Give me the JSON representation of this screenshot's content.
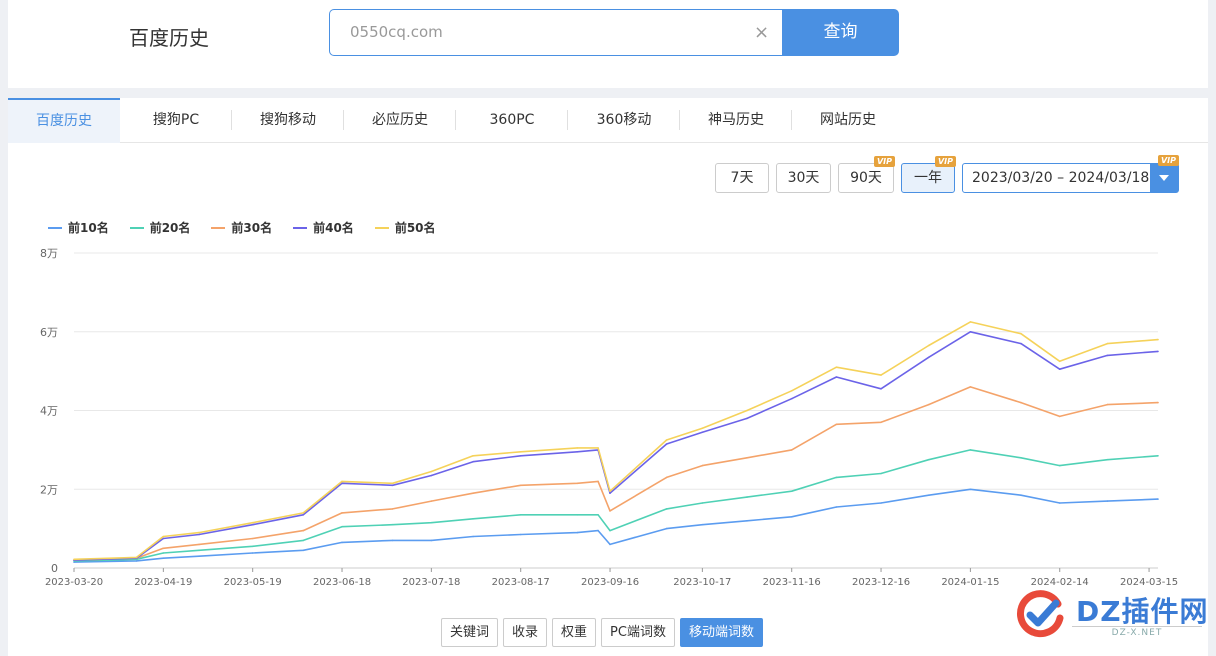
{
  "header": {
    "title": "百度历史",
    "search_value": "0550cq.com",
    "clear_symbol": "×",
    "search_button": "查询"
  },
  "tabs": [
    {
      "label": "百度历史",
      "active": true
    },
    {
      "label": "搜狗PC",
      "active": false
    },
    {
      "label": "搜狗移动",
      "active": false
    },
    {
      "label": "必应历史",
      "active": false
    },
    {
      "label": "360PC",
      "active": false
    },
    {
      "label": "360移动",
      "active": false
    },
    {
      "label": "神马历史",
      "active": false
    },
    {
      "label": "网站历史",
      "active": false
    }
  ],
  "range_buttons": [
    {
      "label": "7天",
      "vip": false,
      "active": false
    },
    {
      "label": "30天",
      "vip": false,
      "active": false
    },
    {
      "label": "90天",
      "vip": true,
      "active": false
    },
    {
      "label": "一年",
      "vip": true,
      "active": true
    }
  ],
  "vip_label": "VIP",
  "date_range": {
    "value": "2023/03/20 – 2024/03/18",
    "vip": true
  },
  "bottom_buttons": [
    {
      "label": "关键词",
      "active": false
    },
    {
      "label": "收录",
      "active": false
    },
    {
      "label": "权重",
      "active": false
    },
    {
      "label": "PC端词数",
      "active": false
    },
    {
      "label": "移动端词数",
      "active": true
    }
  ],
  "watermark": {
    "brand": "DZ插件网",
    "url": "DZ-X.NET"
  },
  "chart_data": {
    "type": "line",
    "title": "",
    "xlabel": "",
    "ylabel": "",
    "ylim": [
      0,
      80000
    ],
    "y_ticks": [
      {
        "value": 0,
        "label": "0"
      },
      {
        "value": 20000,
        "label": "2万"
      },
      {
        "value": 40000,
        "label": "4万"
      },
      {
        "value": 60000,
        "label": "6万"
      },
      {
        "value": 80000,
        "label": "8万"
      }
    ],
    "x_tick_labels": [
      "2023-03-20",
      "2023-04-19",
      "2023-05-19",
      "2023-06-18",
      "2023-07-18",
      "2023-08-17",
      "2023-09-16",
      "2023-10-17",
      "2023-11-16",
      "2023-12-16",
      "2024-01-15",
      "2024-02-14",
      "2024-03-15"
    ],
    "x_range": [
      "2023-03-20",
      "2024-03-18"
    ],
    "grid": "horizontal",
    "legend_position": "top-left",
    "series": [
      {
        "name": "前10名",
        "color": "#5b9cf0",
        "x": [
          "2023-03-20",
          "2023-04-10",
          "2023-04-19",
          "2023-05-01",
          "2023-05-19",
          "2023-06-05",
          "2023-06-18",
          "2023-07-05",
          "2023-07-18",
          "2023-08-01",
          "2023-08-17",
          "2023-09-05",
          "2023-09-12",
          "2023-09-16",
          "2023-10-05",
          "2023-10-17",
          "2023-11-01",
          "2023-11-16",
          "2023-12-01",
          "2023-12-16",
          "2024-01-01",
          "2024-01-15",
          "2024-02-01",
          "2024-02-14",
          "2024-03-01",
          "2024-03-18"
        ],
        "values": [
          1500,
          1800,
          2500,
          3000,
          3800,
          4500,
          6500,
          7000,
          7000,
          8000,
          8500,
          9000,
          9500,
          6000,
          10000,
          11000,
          12000,
          13000,
          15500,
          16500,
          18500,
          20000,
          18500,
          16500,
          17000,
          17500
        ]
      },
      {
        "name": "前20名",
        "color": "#4fd1b5",
        "x": [
          "2023-03-20",
          "2023-04-10",
          "2023-04-19",
          "2023-05-01",
          "2023-05-19",
          "2023-06-05",
          "2023-06-18",
          "2023-07-05",
          "2023-07-18",
          "2023-08-01",
          "2023-08-17",
          "2023-09-05",
          "2023-09-12",
          "2023-09-16",
          "2023-10-05",
          "2023-10-17",
          "2023-11-01",
          "2023-11-16",
          "2023-12-01",
          "2023-12-16",
          "2024-01-01",
          "2024-01-15",
          "2024-02-01",
          "2024-02-14",
          "2024-03-01",
          "2024-03-18"
        ],
        "values": [
          1800,
          2200,
          3800,
          4500,
          5500,
          7000,
          10500,
          11000,
          11500,
          12500,
          13500,
          13500,
          13500,
          9500,
          15000,
          16500,
          18000,
          19500,
          23000,
          24000,
          27500,
          30000,
          28000,
          26000,
          27500,
          28500
        ]
      },
      {
        "name": "前30名",
        "color": "#f4a36a",
        "x": [
          "2023-03-20",
          "2023-04-10",
          "2023-04-19",
          "2023-05-01",
          "2023-05-19",
          "2023-06-05",
          "2023-06-18",
          "2023-07-05",
          "2023-07-18",
          "2023-08-01",
          "2023-08-17",
          "2023-09-05",
          "2023-09-12",
          "2023-09-16",
          "2023-10-05",
          "2023-10-17",
          "2023-11-01",
          "2023-11-16",
          "2023-12-01",
          "2023-12-16",
          "2024-01-01",
          "2024-01-15",
          "2024-02-01",
          "2024-02-14",
          "2024-03-01",
          "2024-03-18"
        ],
        "values": [
          2000,
          2500,
          5000,
          6000,
          7500,
          9500,
          14000,
          15000,
          17000,
          19000,
          21000,
          21500,
          22000,
          14500,
          23000,
          26000,
          28000,
          30000,
          36500,
          37000,
          41500,
          46000,
          42000,
          38500,
          41500,
          42000
        ]
      },
      {
        "name": "前40名",
        "color": "#6b63e8",
        "x": [
          "2023-03-20",
          "2023-04-10",
          "2023-04-19",
          "2023-05-01",
          "2023-05-19",
          "2023-06-05",
          "2023-06-18",
          "2023-07-05",
          "2023-07-18",
          "2023-08-01",
          "2023-08-17",
          "2023-09-05",
          "2023-09-12",
          "2023-09-16",
          "2023-10-05",
          "2023-10-17",
          "2023-11-01",
          "2023-11-16",
          "2023-12-01",
          "2023-12-16",
          "2024-01-01",
          "2024-01-15",
          "2024-02-01",
          "2024-02-14",
          "2024-03-01",
          "2024-03-18"
        ],
        "values": [
          2000,
          2500,
          7500,
          8500,
          11000,
          13500,
          21500,
          21000,
          23500,
          27000,
          28500,
          29500,
          30000,
          19000,
          31500,
          34500,
          38000,
          43000,
          48500,
          45500,
          53500,
          60000,
          57000,
          50500,
          54000,
          55000
        ]
      },
      {
        "name": "前50名",
        "color": "#f5d25a",
        "x": [
          "2023-03-20",
          "2023-04-10",
          "2023-04-19",
          "2023-05-01",
          "2023-05-19",
          "2023-06-05",
          "2023-06-18",
          "2023-07-05",
          "2023-07-18",
          "2023-08-01",
          "2023-08-17",
          "2023-09-05",
          "2023-09-12",
          "2023-09-16",
          "2023-10-05",
          "2023-10-17",
          "2023-11-01",
          "2023-11-16",
          "2023-12-01",
          "2023-12-16",
          "2024-01-01",
          "2024-01-15",
          "2024-02-01",
          "2024-02-14",
          "2024-03-01",
          "2024-03-18"
        ],
        "values": [
          2200,
          2700,
          8000,
          9000,
          11500,
          14000,
          22000,
          21500,
          24500,
          28500,
          29500,
          30500,
          30500,
          19500,
          32500,
          35500,
          40000,
          45000,
          51000,
          49000,
          56500,
          62500,
          59500,
          52500,
          57000,
          58000
        ]
      }
    ]
  }
}
